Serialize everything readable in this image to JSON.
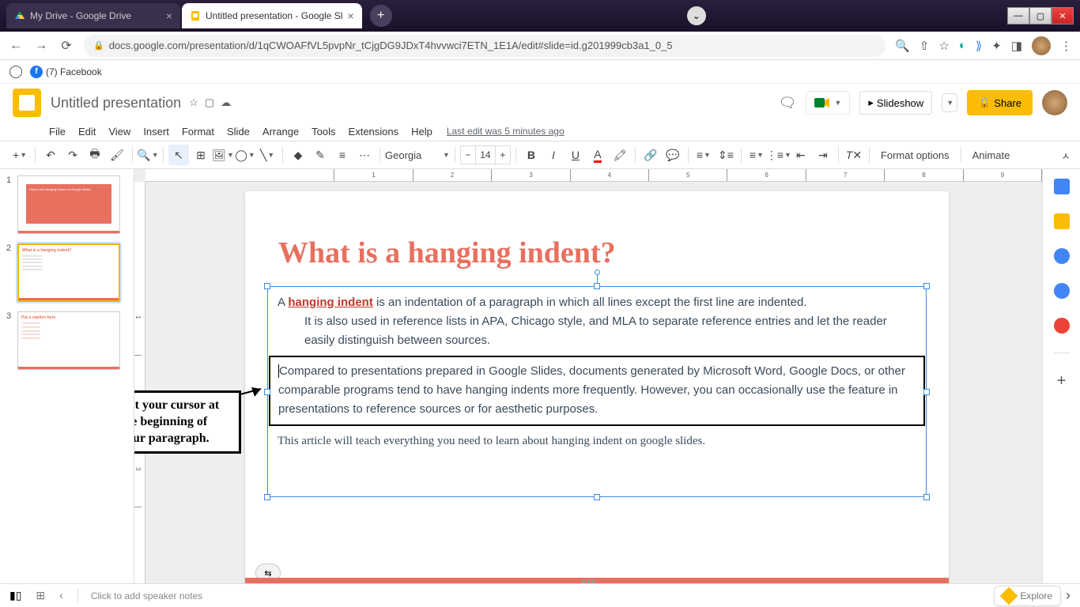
{
  "browser": {
    "tabs": [
      {
        "title": "My Drive - Google Drive",
        "favicon": "drive"
      },
      {
        "title": "Untitled presentation - Google Sl",
        "favicon": "slides"
      }
    ],
    "url": "docs.google.com/presentation/d/1qCWOAFfVL5pvpNr_tCjgDG9JDxT4hvvwci7ETN_1E1A/edit#slide=id.g201999cb3a1_0_5",
    "bookmarks": [
      {
        "label": "(7) Facebook"
      }
    ]
  },
  "header": {
    "doc_title": "Untitled presentation",
    "slideshow": "Slideshow",
    "share": "Share"
  },
  "menus": [
    "File",
    "Edit",
    "View",
    "Insert",
    "Format",
    "Slide",
    "Arrange",
    "Tools",
    "Extensions",
    "Help"
  ],
  "last_edit": "Last edit was 5 minutes ago",
  "toolbar": {
    "font": "Georgia",
    "size": "14",
    "format_options": "Format options",
    "animate": "Animate"
  },
  "ruler_h": [
    "",
    "1",
    "2",
    "3",
    "4",
    "5",
    "6",
    "7",
    "8",
    "9"
  ],
  "ruler_v": [
    "1",
    "2",
    "3"
  ],
  "slide": {
    "title": "What is a hanging indent?",
    "p1_a": "A ",
    "p1_link": "hanging indent",
    "p1_b": " is an indentation of a paragraph in which all lines except the first line are indented.",
    "p1_c": "It is also used in reference lists in APA, Chicago style, and MLA to separate reference entries and let the reader easily distinguish between sources.",
    "p2": "Compared to presentations prepared in Google Slides, documents generated by Microsoft Word, Google Docs, or other comparable programs tend to have hanging indents more frequently. However, you can occasionally use the feature in presentations to reference sources or for aesthetic purposes.",
    "p3": "This article will teach everything you need to learn about hanging indent on google slides."
  },
  "callout": "Put your cursor at the beginning of your paragraph.",
  "thumbs": {
    "t1_text": "How to do Hanging Indent on Google Slides",
    "t2_title": "What is a hanging indent?",
    "t3_title": "Put a caption here"
  },
  "bottom": {
    "notes": "Click to add speaker notes",
    "explore": "Explore"
  }
}
